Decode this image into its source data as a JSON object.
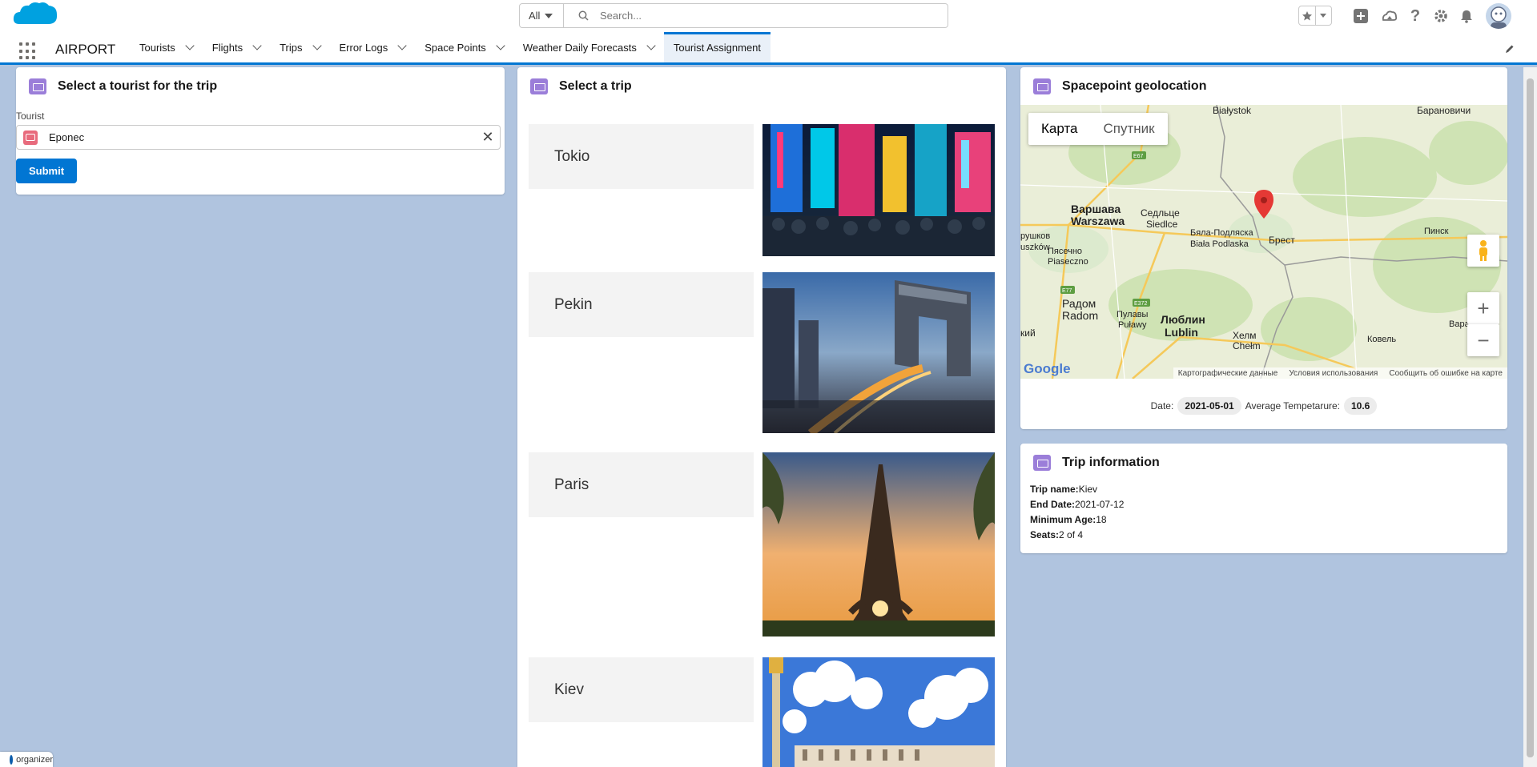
{
  "header": {
    "search_scope": "All",
    "search_placeholder": "Search..."
  },
  "nav": {
    "app_name": "AIRPORT",
    "items": [
      {
        "label": "Tourists"
      },
      {
        "label": "Flights"
      },
      {
        "label": "Trips"
      },
      {
        "label": "Error Logs"
      },
      {
        "label": "Space Points"
      },
      {
        "label": "Weather Daily Forecasts"
      }
    ],
    "active_tab": "Tourist Assignment"
  },
  "tourist_card": {
    "title": "Select a tourist for the trip",
    "field_label": "Tourist",
    "field_value": "Eponec",
    "submit_label": "Submit"
  },
  "trip_card": {
    "title": "Select a trip",
    "trips": [
      {
        "name": "Tokio"
      },
      {
        "name": "Pekin"
      },
      {
        "name": "Paris"
      },
      {
        "name": "Kiev"
      }
    ]
  },
  "geo_card": {
    "title": "Spacepoint geolocation",
    "map_type_map": "Карта",
    "map_type_satellite": "Спутник",
    "map_footer": [
      "Картографические данные",
      "Условия использования",
      "Сообщить об ошибке на карте"
    ],
    "google_label": "Google",
    "date_label": "Date:",
    "date_value": "2021-05-01",
    "temp_label": "Average Tempetarure:",
    "temp_value": "10.6"
  },
  "trip_info": {
    "title": "Trip information",
    "name_label": "Trip name:",
    "name_value": "Kiev",
    "end_label": "End Date:",
    "end_value": "2021-07-12",
    "age_label": "Minimum Age:",
    "age_value": "18",
    "seats_label": "Seats:",
    "seats_value": "2 of 4"
  },
  "organizer": "organizer"
}
